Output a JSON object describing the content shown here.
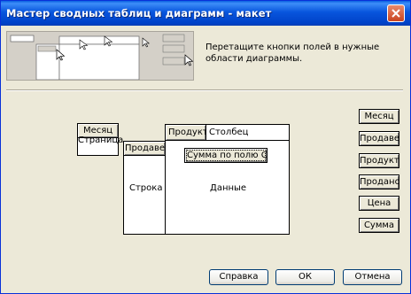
{
  "window": {
    "title": "Мастер сводных таблиц и диаграмм - макет"
  },
  "instructions": "Перетащите кнопки полей в нужные области диаграммы.",
  "layout": {
    "page_field": {
      "button": "Месяц",
      "label": "Страница"
    },
    "column_field": {
      "buttons": [
        "Продукт",
        "Столбец"
      ]
    },
    "row_field": {
      "button": "Продавец",
      "label": "Строка"
    },
    "data_field": {
      "button": "Сумма по полю Сум",
      "label": "Данные"
    }
  },
  "fields": [
    "Месяц",
    "Продавец",
    "Продукт",
    "Продано",
    "Цена",
    "Сумма"
  ],
  "buttons": {
    "help": "Справка",
    "ok": "ОК",
    "cancel": "Отмена"
  },
  "colors": {
    "titlebar": "#0855dd",
    "window_bg": "#ece9d8",
    "close_button": "#c9441f"
  }
}
